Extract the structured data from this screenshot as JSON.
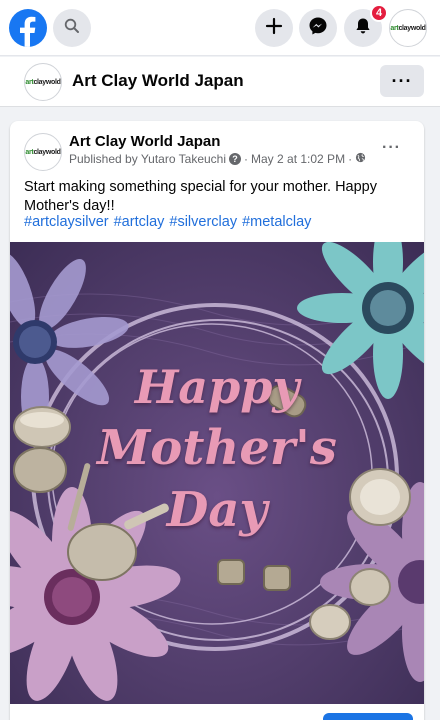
{
  "topbar": {
    "notification_count": "4",
    "profile_logo_part1": "art",
    "profile_logo_part2": "claywold"
  },
  "page_header": {
    "title": "Art Clay World Japan",
    "more_label": "···"
  },
  "post": {
    "author": "Art Clay World Japan",
    "published_by": "Published by Yutaro Takeuchi",
    "date": "May 2 at 1:02 PM",
    "separator": "·",
    "more_label": "···",
    "text": "Start making something special for your mother. Happy Mother's day!!",
    "hashtags": [
      "#artclaysilver",
      "#artclay",
      "#silverclay",
      "#metalclay"
    ],
    "image_text": {
      "line1": "Happy",
      "line2": "Mother's",
      "line3": "Day"
    }
  },
  "colors": {
    "facebook_blue": "#1877f2",
    "hashtag_blue": "#216fdb",
    "badge_red": "#e41e3f",
    "image_text_pink": "#e89ab5"
  },
  "icons": [
    "facebook-logo-icon",
    "search-icon",
    "plus-icon",
    "messenger-icon",
    "bell-icon",
    "help-icon",
    "globe-icon",
    "more-icon"
  ]
}
